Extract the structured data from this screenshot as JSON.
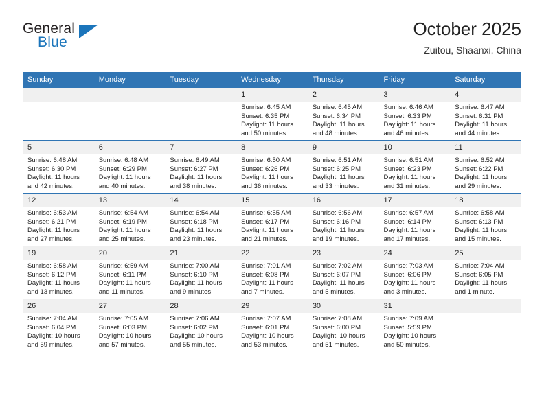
{
  "brand": {
    "name_part1": "General",
    "name_part2": "Blue",
    "accent_color": "#1b75bb",
    "triangle_icon": "brand-triangle-icon"
  },
  "header": {
    "title": "October 2025",
    "location": "Zuitou, Shaanxi, China"
  },
  "theme": {
    "header_bar_color": "#3075b4",
    "daynum_band_color": "#f0f0f0",
    "text_color": "#222222"
  },
  "weekday_headers": [
    "Sunday",
    "Monday",
    "Tuesday",
    "Wednesday",
    "Thursday",
    "Friday",
    "Saturday"
  ],
  "weeks": [
    [
      {
        "day": "",
        "empty": true
      },
      {
        "day": "",
        "empty": true
      },
      {
        "day": "",
        "empty": true
      },
      {
        "day": "1",
        "sunrise": "Sunrise: 6:45 AM",
        "sunset": "Sunset: 6:35 PM",
        "daylight_line1": "Daylight: 11 hours",
        "daylight_line2": "and 50 minutes."
      },
      {
        "day": "2",
        "sunrise": "Sunrise: 6:45 AM",
        "sunset": "Sunset: 6:34 PM",
        "daylight_line1": "Daylight: 11 hours",
        "daylight_line2": "and 48 minutes."
      },
      {
        "day": "3",
        "sunrise": "Sunrise: 6:46 AM",
        "sunset": "Sunset: 6:33 PM",
        "daylight_line1": "Daylight: 11 hours",
        "daylight_line2": "and 46 minutes."
      },
      {
        "day": "4",
        "sunrise": "Sunrise: 6:47 AM",
        "sunset": "Sunset: 6:31 PM",
        "daylight_line1": "Daylight: 11 hours",
        "daylight_line2": "and 44 minutes."
      }
    ],
    [
      {
        "day": "5",
        "sunrise": "Sunrise: 6:48 AM",
        "sunset": "Sunset: 6:30 PM",
        "daylight_line1": "Daylight: 11 hours",
        "daylight_line2": "and 42 minutes."
      },
      {
        "day": "6",
        "sunrise": "Sunrise: 6:48 AM",
        "sunset": "Sunset: 6:29 PM",
        "daylight_line1": "Daylight: 11 hours",
        "daylight_line2": "and 40 minutes."
      },
      {
        "day": "7",
        "sunrise": "Sunrise: 6:49 AM",
        "sunset": "Sunset: 6:27 PM",
        "daylight_line1": "Daylight: 11 hours",
        "daylight_line2": "and 38 minutes."
      },
      {
        "day": "8",
        "sunrise": "Sunrise: 6:50 AM",
        "sunset": "Sunset: 6:26 PM",
        "daylight_line1": "Daylight: 11 hours",
        "daylight_line2": "and 36 minutes."
      },
      {
        "day": "9",
        "sunrise": "Sunrise: 6:51 AM",
        "sunset": "Sunset: 6:25 PM",
        "daylight_line1": "Daylight: 11 hours",
        "daylight_line2": "and 33 minutes."
      },
      {
        "day": "10",
        "sunrise": "Sunrise: 6:51 AM",
        "sunset": "Sunset: 6:23 PM",
        "daylight_line1": "Daylight: 11 hours",
        "daylight_line2": "and 31 minutes."
      },
      {
        "day": "11",
        "sunrise": "Sunrise: 6:52 AM",
        "sunset": "Sunset: 6:22 PM",
        "daylight_line1": "Daylight: 11 hours",
        "daylight_line2": "and 29 minutes."
      }
    ],
    [
      {
        "day": "12",
        "sunrise": "Sunrise: 6:53 AM",
        "sunset": "Sunset: 6:21 PM",
        "daylight_line1": "Daylight: 11 hours",
        "daylight_line2": "and 27 minutes."
      },
      {
        "day": "13",
        "sunrise": "Sunrise: 6:54 AM",
        "sunset": "Sunset: 6:19 PM",
        "daylight_line1": "Daylight: 11 hours",
        "daylight_line2": "and 25 minutes."
      },
      {
        "day": "14",
        "sunrise": "Sunrise: 6:54 AM",
        "sunset": "Sunset: 6:18 PM",
        "daylight_line1": "Daylight: 11 hours",
        "daylight_line2": "and 23 minutes."
      },
      {
        "day": "15",
        "sunrise": "Sunrise: 6:55 AM",
        "sunset": "Sunset: 6:17 PM",
        "daylight_line1": "Daylight: 11 hours",
        "daylight_line2": "and 21 minutes."
      },
      {
        "day": "16",
        "sunrise": "Sunrise: 6:56 AM",
        "sunset": "Sunset: 6:16 PM",
        "daylight_line1": "Daylight: 11 hours",
        "daylight_line2": "and 19 minutes."
      },
      {
        "day": "17",
        "sunrise": "Sunrise: 6:57 AM",
        "sunset": "Sunset: 6:14 PM",
        "daylight_line1": "Daylight: 11 hours",
        "daylight_line2": "and 17 minutes."
      },
      {
        "day": "18",
        "sunrise": "Sunrise: 6:58 AM",
        "sunset": "Sunset: 6:13 PM",
        "daylight_line1": "Daylight: 11 hours",
        "daylight_line2": "and 15 minutes."
      }
    ],
    [
      {
        "day": "19",
        "sunrise": "Sunrise: 6:58 AM",
        "sunset": "Sunset: 6:12 PM",
        "daylight_line1": "Daylight: 11 hours",
        "daylight_line2": "and 13 minutes."
      },
      {
        "day": "20",
        "sunrise": "Sunrise: 6:59 AM",
        "sunset": "Sunset: 6:11 PM",
        "daylight_line1": "Daylight: 11 hours",
        "daylight_line2": "and 11 minutes."
      },
      {
        "day": "21",
        "sunrise": "Sunrise: 7:00 AM",
        "sunset": "Sunset: 6:10 PM",
        "daylight_line1": "Daylight: 11 hours",
        "daylight_line2": "and 9 minutes."
      },
      {
        "day": "22",
        "sunrise": "Sunrise: 7:01 AM",
        "sunset": "Sunset: 6:08 PM",
        "daylight_line1": "Daylight: 11 hours",
        "daylight_line2": "and 7 minutes."
      },
      {
        "day": "23",
        "sunrise": "Sunrise: 7:02 AM",
        "sunset": "Sunset: 6:07 PM",
        "daylight_line1": "Daylight: 11 hours",
        "daylight_line2": "and 5 minutes."
      },
      {
        "day": "24",
        "sunrise": "Sunrise: 7:03 AM",
        "sunset": "Sunset: 6:06 PM",
        "daylight_line1": "Daylight: 11 hours",
        "daylight_line2": "and 3 minutes."
      },
      {
        "day": "25",
        "sunrise": "Sunrise: 7:04 AM",
        "sunset": "Sunset: 6:05 PM",
        "daylight_line1": "Daylight: 11 hours",
        "daylight_line2": "and 1 minute."
      }
    ],
    [
      {
        "day": "26",
        "sunrise": "Sunrise: 7:04 AM",
        "sunset": "Sunset: 6:04 PM",
        "daylight_line1": "Daylight: 10 hours",
        "daylight_line2": "and 59 minutes."
      },
      {
        "day": "27",
        "sunrise": "Sunrise: 7:05 AM",
        "sunset": "Sunset: 6:03 PM",
        "daylight_line1": "Daylight: 10 hours",
        "daylight_line2": "and 57 minutes."
      },
      {
        "day": "28",
        "sunrise": "Sunrise: 7:06 AM",
        "sunset": "Sunset: 6:02 PM",
        "daylight_line1": "Daylight: 10 hours",
        "daylight_line2": "and 55 minutes."
      },
      {
        "day": "29",
        "sunrise": "Sunrise: 7:07 AM",
        "sunset": "Sunset: 6:01 PM",
        "daylight_line1": "Daylight: 10 hours",
        "daylight_line2": "and 53 minutes."
      },
      {
        "day": "30",
        "sunrise": "Sunrise: 7:08 AM",
        "sunset": "Sunset: 6:00 PM",
        "daylight_line1": "Daylight: 10 hours",
        "daylight_line2": "and 51 minutes."
      },
      {
        "day": "31",
        "sunrise": "Sunrise: 7:09 AM",
        "sunset": "Sunset: 5:59 PM",
        "daylight_line1": "Daylight: 10 hours",
        "daylight_line2": "and 50 minutes."
      },
      {
        "day": "",
        "empty": true
      }
    ]
  ]
}
